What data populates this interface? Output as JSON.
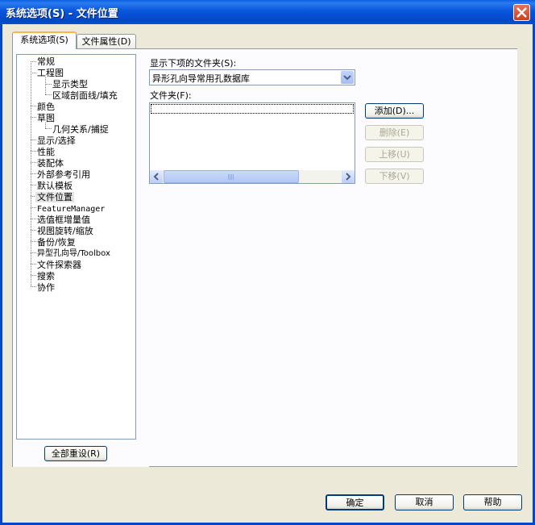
{
  "window": {
    "title": "系统选项(S) - 文件位置"
  },
  "tabs": [
    {
      "label": "系统选项(S)",
      "active": true
    },
    {
      "label": "文件属性(D)",
      "active": false
    }
  ],
  "tree": {
    "items": [
      {
        "label": "常规",
        "level": 0
      },
      {
        "label": "工程图",
        "level": 0
      },
      {
        "label": "显示类型",
        "level": 1
      },
      {
        "label": "区域剖面线/填充",
        "level": 1
      },
      {
        "label": "颜色",
        "level": 0
      },
      {
        "label": "草图",
        "level": 0
      },
      {
        "label": "几何关系/捕捉",
        "level": 1
      },
      {
        "label": "显示/选择",
        "level": 0
      },
      {
        "label": "性能",
        "level": 0
      },
      {
        "label": "装配体",
        "level": 0
      },
      {
        "label": "外部参考引用",
        "level": 0
      },
      {
        "label": "默认模板",
        "level": 0
      },
      {
        "label": "文件位置",
        "level": 0,
        "selected": true
      },
      {
        "label": "FeatureManager",
        "level": 0
      },
      {
        "label": "选值框增量值",
        "level": 0
      },
      {
        "label": "视图旋转/缩放",
        "level": 0
      },
      {
        "label": "备份/恢复",
        "level": 0
      },
      {
        "label": "异型孔向导/Toolbox",
        "level": 0
      },
      {
        "label": "文件探索器",
        "level": 0
      },
      {
        "label": "搜索",
        "level": 0
      },
      {
        "label": "协作",
        "level": 0
      }
    ],
    "reset_button": "全部重设(R)"
  },
  "folders": {
    "show_label": "显示下项的文件夹(S):",
    "selected_option": "异形孔向导常用孔数据库",
    "list_label": "文件夹(F):",
    "add_button": "添加(D)...",
    "delete_button": "删除(E)",
    "move_up_button": "上移(U)",
    "move_down_button": "下移(V)"
  },
  "footer": {
    "ok": "确定",
    "cancel": "取消",
    "help": "帮助"
  },
  "colors": {
    "titlebar": "#0A5FE0",
    "dialog_bg": "#ECE9D8",
    "tab_accent": "#F5B849",
    "selection": "#E4E4E4"
  }
}
